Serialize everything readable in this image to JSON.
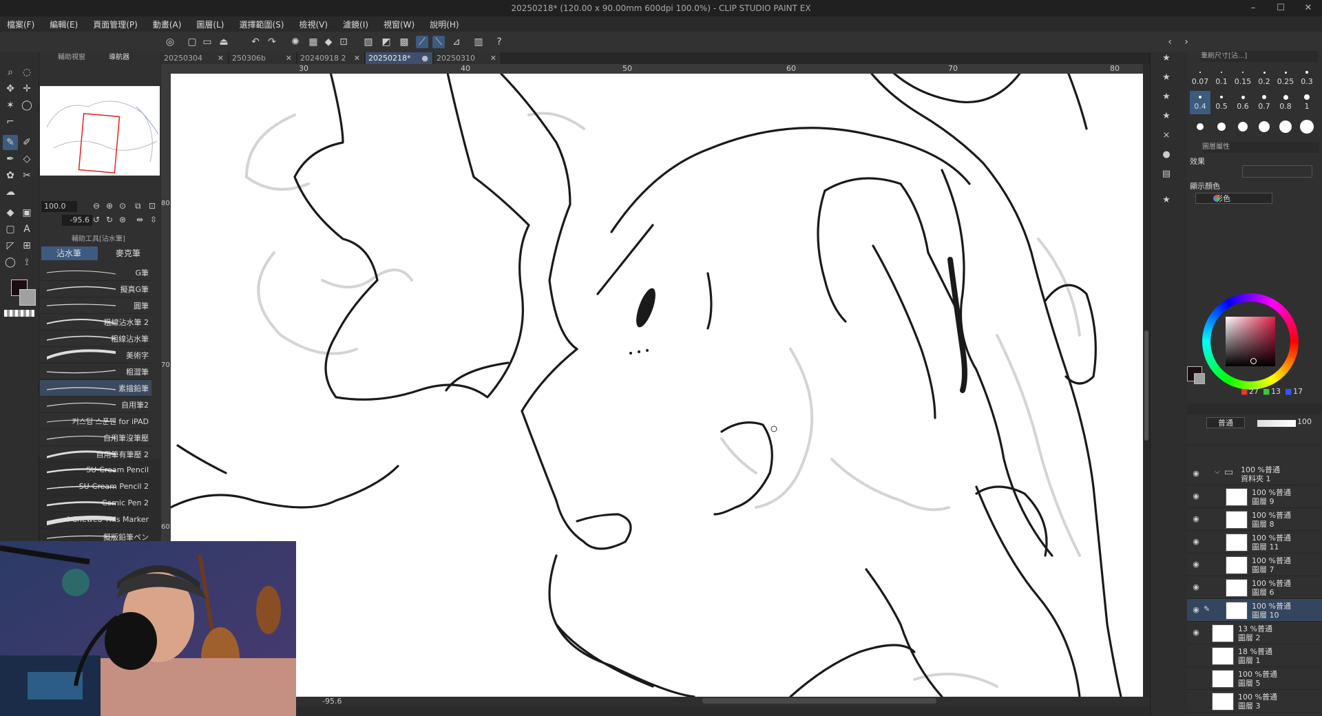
{
  "window": {
    "title": "20250218* (120.00 x 90.00mm 600dpi 100.0%) - CLIP STUDIO PAINT EX",
    "min": "–",
    "max": "☐",
    "close": "✕"
  },
  "menu": [
    "檔案(F)",
    "編輯(E)",
    "頁面管理(P)",
    "動畫(A)",
    "圖層(L)",
    "選擇範圍(S)",
    "檢視(V)",
    "濾鏡(I)",
    "視窗(W)",
    "說明(H)"
  ],
  "nav": {
    "tab1": "輔助視窗",
    "tab2": "導航器",
    "zoom": "100.0",
    "angle": "-95.6"
  },
  "subtool": {
    "title": "輔助工具[沾水筆]",
    "tabs": [
      "沾水筆",
      "麥克筆"
    ],
    "brushes": [
      "G筆",
      "擬真G筆",
      "圓筆",
      "粗線沾水筆 2",
      "粗線沾水筆",
      "美術字",
      "粗澀筆",
      "素描鉛筆",
      "自用筆2",
      "커스텀 스푼펜 for iPAD",
      "自用筆沒筆壓",
      "自用筆有筆壓 2",
      "SU-Cream Pencil",
      "SU-Cream Pencil 2",
      "Comic Pen 2",
      "I Chewed This Marker",
      "擬版鉛筆ペン"
    ],
    "selected_index": 7
  },
  "tabs": [
    {
      "label": "20250304"
    },
    {
      "label": "250306b"
    },
    {
      "label": "20240918 2"
    },
    {
      "label": "20250218*",
      "active": true
    },
    {
      "label": "20250310"
    }
  ],
  "tab_close": "✕",
  "tab_dot": "●",
  "ruler": {
    "h": [
      "30",
      "40",
      "50",
      "60",
      "70",
      "80"
    ],
    "v": [
      "80",
      "70",
      "60"
    ]
  },
  "status": {
    "angle": "-95.6"
  },
  "brush_size": {
    "panel_title": "筆刷尺寸[沾...]",
    "sizes": [
      "0.07",
      "0.1",
      "0.15",
      "0.2",
      "0.25",
      "0.3",
      "0.4",
      "0.5",
      "0.6",
      "0.7",
      "0.8",
      "1"
    ],
    "selected": "0.4"
  },
  "layer_prop": {
    "title": "圖層屬性",
    "effect_label": "效果",
    "color_label": "顯示顏色",
    "color_value": "彩色"
  },
  "color": {
    "r": "27",
    "g": "13",
    "b": "17",
    "main_color": "#1b0d11",
    "sub_color": "#a0a0a0"
  },
  "layers_panel": {
    "blend": "普通",
    "opacity": "100"
  },
  "layers": [
    {
      "line1": "100 %普通",
      "line2": "資料夾 1",
      "folder": true,
      "visible": true
    },
    {
      "line1": "100 %普通",
      "line2": "圖層 9",
      "visible": true
    },
    {
      "line1": "100 %普通",
      "line2": "圖層 8",
      "visible": true
    },
    {
      "line1": "100 %普通",
      "line2": "圖層 11",
      "visible": true
    },
    {
      "line1": "100 %普通",
      "line2": "圖層 7",
      "visible": true
    },
    {
      "line1": "100 %普通",
      "line2": "圖層 6",
      "visible": true
    },
    {
      "line1": "100 %普通",
      "line2": "圖層 10",
      "visible": true,
      "selected": true
    },
    {
      "line1": "13 %普通",
      "line2": "圖層 2",
      "visible": true
    },
    {
      "line1": "18 %普通",
      "line2": "圖層 1",
      "visible": false
    },
    {
      "line1": "100 %普通",
      "line2": "圖層 5",
      "visible": false
    },
    {
      "line1": "100 %普通",
      "line2": "圖層 3",
      "visible": false
    }
  ]
}
